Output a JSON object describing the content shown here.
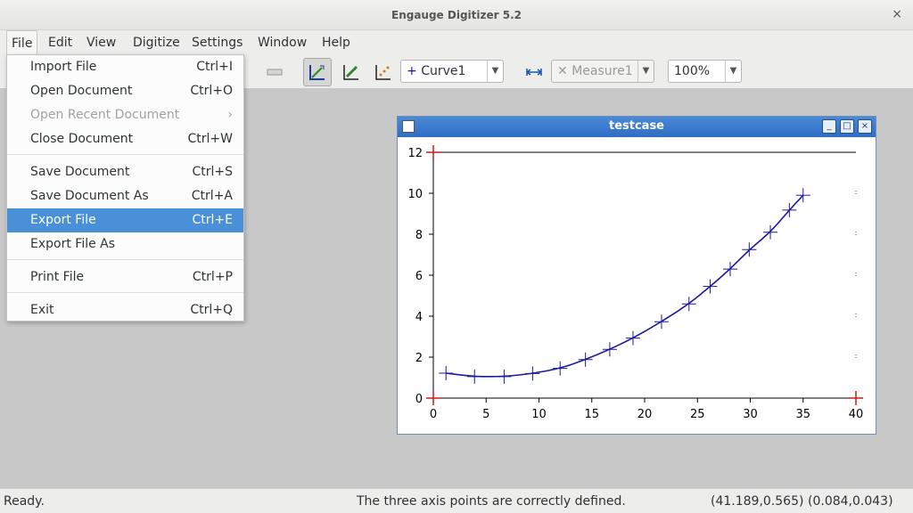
{
  "window": {
    "title": "Engauge Digitizer 5.2",
    "close_glyph": "×"
  },
  "menubar": [
    "File",
    "Edit",
    "View",
    "Digitize",
    "Settings",
    "Window",
    "Help"
  ],
  "toolbar": {
    "curve_combo": "Curve1",
    "measure_combo": "Measure1",
    "zoom_combo": "100%",
    "icons": [
      "segment-icon",
      "axis-point-icon",
      "curve-point-icon",
      "pencil-icon",
      "color-picker-icon",
      "measure-icon"
    ]
  },
  "file_menu": {
    "items": [
      {
        "label": "Import File",
        "accel": "Ctrl+I",
        "state": "normal"
      },
      {
        "label": "Open Document",
        "accel": "Ctrl+O",
        "state": "normal"
      },
      {
        "label": "Open Recent Document",
        "accel": "›",
        "state": "disabled"
      },
      {
        "label": "Close Document",
        "accel": "Ctrl+W",
        "state": "normal"
      },
      {
        "label": "Save Document",
        "accel": "Ctrl+S",
        "state": "normal"
      },
      {
        "label": "Save Document As",
        "accel": "Ctrl+A",
        "state": "normal"
      },
      {
        "label": "Export File",
        "accel": "Ctrl+E",
        "state": "highlighted"
      },
      {
        "label": "Export File As",
        "accel": "",
        "state": "normal"
      },
      {
        "label": "Print File",
        "accel": "Ctrl+P",
        "state": "normal"
      },
      {
        "label": "Exit",
        "accel": "Ctrl+Q",
        "state": "normal"
      }
    ]
  },
  "subwindow": {
    "title": "testcase",
    "min_glyph": "_",
    "max_glyph": "□",
    "close_glyph": "×"
  },
  "chart_data": {
    "type": "line",
    "title": "",
    "xlabel": "",
    "ylabel": "",
    "xlim": [
      0,
      40
    ],
    "ylim": [
      0,
      12
    ],
    "xticks": [
      0,
      5,
      10,
      15,
      20,
      25,
      30,
      35,
      40
    ],
    "yticks": [
      0,
      2,
      4,
      6,
      8,
      10,
      12
    ],
    "axis_points": [
      [
        0,
        12
      ],
      [
        0,
        0
      ],
      [
        40,
        0
      ]
    ],
    "series": [
      {
        "color": "#1a1aa0",
        "x": [
          1.2,
          3.9,
          6.7,
          9.4,
          12.0,
          14.4,
          16.7,
          18.9,
          21.6,
          24.2,
          26.2,
          28.1,
          29.9,
          31.9,
          33.7,
          35.0
        ],
        "y": [
          1.22,
          1.05,
          1.05,
          1.2,
          1.45,
          1.88,
          2.38,
          2.93,
          3.73,
          4.6,
          5.45,
          6.3,
          7.25,
          8.1,
          9.18,
          9.9
        ]
      }
    ],
    "colors": {
      "axis_point": "#d01818",
      "series": "#1a1aa0"
    }
  },
  "status": {
    "left": "Ready.",
    "middle": "The three axis points are correctly defined.",
    "coords_screen": "(41.189,0.565)",
    "coords_graph": "(0.084,0.043)"
  }
}
